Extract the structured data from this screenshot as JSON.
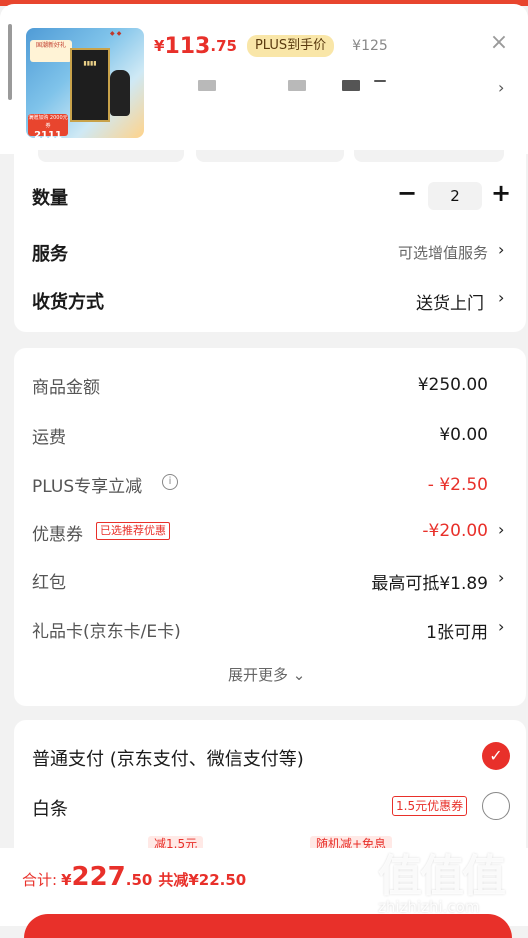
{
  "colors": {
    "accent": "#e8302a",
    "plus_badge_bg": "#f9e6a8",
    "background": "#f2f2f2"
  },
  "product": {
    "price_currency": "¥",
    "price_integer": "113",
    "price_decimal": ".75",
    "plus_badge": "PLUS到手价",
    "original_price": "¥125",
    "close_icon": "close-icon",
    "image_texts": {
      "promo_top": "国潮新好礼",
      "promo_bottom_small": "满赠加购 2000元券",
      "promo_bottom_num": "2111"
    }
  },
  "quantity": {
    "label": "数量",
    "value": "2",
    "minus": "−",
    "plus": "+"
  },
  "service": {
    "label": "服务",
    "value": "可选增值服务"
  },
  "delivery": {
    "label": "收货方式",
    "value": "送货上门"
  },
  "fees": {
    "goods_amount": {
      "label": "商品金额",
      "value": "¥250.00"
    },
    "shipping": {
      "label": "运费",
      "value": "¥0.00"
    },
    "plus_discount": {
      "label": "PLUS专享立减",
      "value": "- ¥2.50"
    },
    "coupon": {
      "label": "优惠券",
      "tag": "已选推荐优惠",
      "value": "-¥20.00"
    },
    "red_packet": {
      "label": "红包",
      "value": "最高可抵¥1.89"
    },
    "gift_card": {
      "label": "礼品卡(京东卡/E卡)",
      "value": "1张可用"
    },
    "expand_more": "展开更多"
  },
  "payment": {
    "normal": {
      "label": "普通支付 (京东支付、微信支付等)",
      "selected": true
    },
    "baitiao": {
      "label": "白条",
      "tag": "1.5元优惠券",
      "selected": false
    },
    "installment_tags": [
      "减1.5元",
      "随机减+免息"
    ]
  },
  "footer": {
    "total_label": "合计:",
    "currency": "¥",
    "total_integer": "227",
    "total_decimal": ".50",
    "saved": "共减¥22.50"
  },
  "watermark": {
    "glyphs": "值值值",
    "url": "zhizhizhi.com"
  }
}
